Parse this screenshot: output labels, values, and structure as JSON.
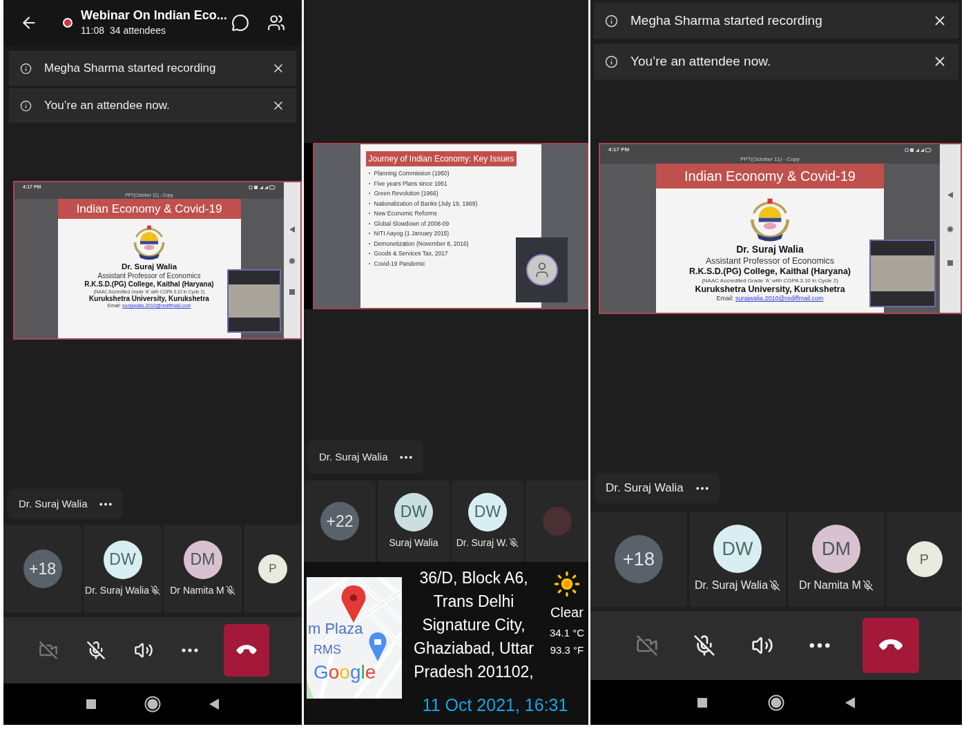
{
  "panels": [
    {
      "kind": "call",
      "header": {
        "title": "Webinar On Indian Eco...",
        "time": "11:08",
        "attendees": "34 attendees",
        "recording": true
      },
      "notifications": [
        {
          "text": "Megha Sharma started recording"
        },
        {
          "text": "You’re an attendee now."
        }
      ],
      "shared_screen": {
        "kind": "title_slide",
        "status_time": "4:17 PM",
        "doc_title": "PPT(October 11) - Copy",
        "title": "Indian Economy & Covid-19",
        "presenter": "Dr. Suraj Walia",
        "lines": [
          {
            "kind": "regular",
            "text": "Assistant Professor of Economics"
          },
          {
            "kind": "bold",
            "text": "R.K.S.D.(PG) College, Kaithal (Haryana)"
          },
          {
            "kind": "small",
            "text": "(NAAC Accredited Grade 'A' with CGPA 3.10 in Cycle 2)"
          },
          {
            "kind": "bold",
            "text": "Kurukshetra University, Kurukshetra"
          }
        ],
        "email_label": "Email:",
        "email": "surajwalia.2010@rediffmail.com"
      },
      "speaker": {
        "name": "Dr. Suraj Walia"
      },
      "participants": [
        {
          "kind": "overflow",
          "count": "+18"
        },
        {
          "kind": "initials",
          "initials": "DW",
          "name": "Dr. Suraj Walia",
          "muted": true,
          "color": "#d9eef2"
        },
        {
          "kind": "initials",
          "initials": "DM",
          "name": "Dr Namita M",
          "muted": true,
          "color": "#d8c1d0"
        },
        {
          "kind": "initials",
          "initials": "P",
          "color": "#e8ebdd"
        }
      ],
      "controls": {
        "camera_off": true,
        "mic_muted": true
      }
    },
    {
      "kind": "geotagged",
      "shared_screen": {
        "kind": "bullet_slide",
        "title": "Journey of Indian Economy: Key Issues",
        "bullets": [
          "Planning Commission (1950)",
          "Five years Plans since 1951",
          "Green Revolution (1966)",
          "Nationalization of Banks (July 19, 1969)",
          "New Economic Reforms",
          "Global Slowdown of 2008-09",
          "NITI Aayog (1 January 2015)",
          "Demonetization  (November 8, 2016)",
          "Goods & Services Tax, 2017",
          "Covid-19 Pandemic"
        ]
      },
      "speaker": {
        "name": "Dr. Suraj Walia"
      },
      "participants": [
        {
          "kind": "overflow",
          "count": "+22"
        },
        {
          "kind": "initials",
          "initials": "DW",
          "name": "Suraj Walia",
          "muted": false,
          "color": "#c9dfe2"
        },
        {
          "kind": "initials",
          "initials": "DW",
          "name": "Dr. Suraj W.",
          "muted": true,
          "color": "#d9eef2"
        },
        {
          "kind": "photo"
        }
      ],
      "geotag": {
        "map_labels": [
          "m Plaza",
          "RMS"
        ],
        "map_brand": "Google",
        "address": "36/D, Block A6, Trans Delhi Signature City, Ghaziabad, Uttar Pradesh 201102,",
        "weather": "Clear",
        "temp_c": "34.1 °C",
        "temp_f": "93.3 °F",
        "datetime": "11 Oct 2021, 16:31"
      }
    },
    {
      "kind": "call",
      "notifications": [
        {
          "text": "Megha Sharma started recording"
        },
        {
          "text": "You’re an attendee now."
        }
      ],
      "shared_screen": {
        "kind": "title_slide",
        "status_time": "4:17 PM",
        "doc_title": "PPT(October 11) - Copy",
        "title": "Indian Economy & Covid-19",
        "presenter": "Dr. Suraj Walia",
        "lines": [
          {
            "kind": "regular",
            "text": "Assistant Professor of Economics"
          },
          {
            "kind": "bold",
            "text": "R.K.S.D.(PG) College, Kaithal (Haryana)"
          },
          {
            "kind": "small",
            "text": "(NAAC Accredited Grade 'A' with CGPA 3.10 in Cycle 2)"
          },
          {
            "kind": "bold",
            "text": "Kurukshetra University, Kurukshetra"
          }
        ],
        "email_label": "Email:",
        "email": "surajwalia.2010@rediffmail.com"
      },
      "speaker": {
        "name": "Dr. Suraj Walia"
      },
      "participants": [
        {
          "kind": "overflow",
          "count": "+18"
        },
        {
          "kind": "initials",
          "initials": "DW",
          "name": "Dr. Suraj Walia",
          "muted": true,
          "color": "#d9eef2"
        },
        {
          "kind": "initials",
          "initials": "DM",
          "name": "Dr Namita M",
          "muted": true,
          "color": "#d8c1d0"
        },
        {
          "kind": "initials",
          "initials": "P",
          "color": "#e8ebdd"
        }
      ],
      "controls": {
        "camera_off": true,
        "mic_muted": true
      }
    }
  ]
}
